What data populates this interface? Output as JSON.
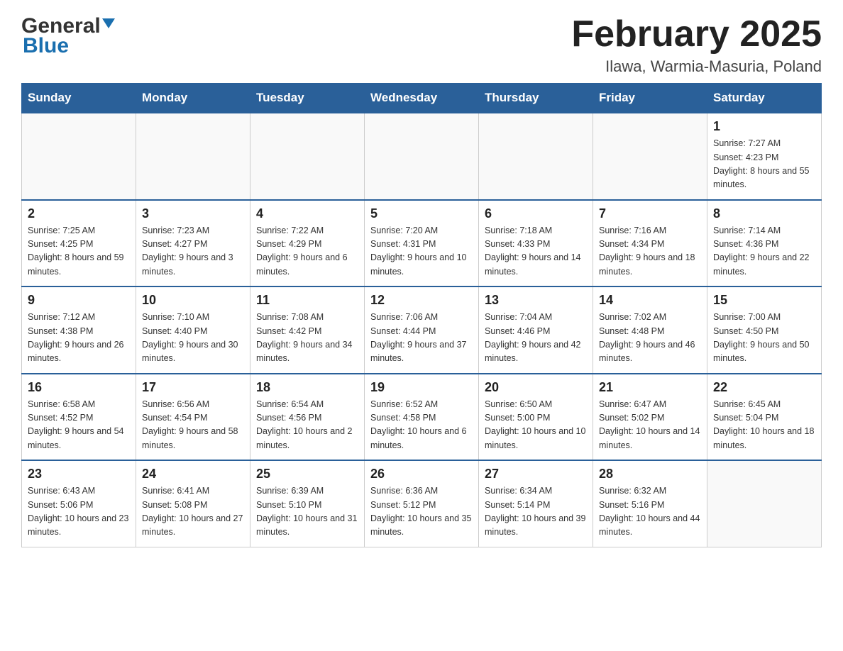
{
  "header": {
    "logo_main": "General",
    "logo_accent": "Blue",
    "month_title": "February 2025",
    "location": "Ilawa, Warmia-Masuria, Poland"
  },
  "weekdays": [
    "Sunday",
    "Monday",
    "Tuesday",
    "Wednesday",
    "Thursday",
    "Friday",
    "Saturday"
  ],
  "weeks": [
    [
      {
        "day": "",
        "info": ""
      },
      {
        "day": "",
        "info": ""
      },
      {
        "day": "",
        "info": ""
      },
      {
        "day": "",
        "info": ""
      },
      {
        "day": "",
        "info": ""
      },
      {
        "day": "",
        "info": ""
      },
      {
        "day": "1",
        "info": "Sunrise: 7:27 AM\nSunset: 4:23 PM\nDaylight: 8 hours and 55 minutes."
      }
    ],
    [
      {
        "day": "2",
        "info": "Sunrise: 7:25 AM\nSunset: 4:25 PM\nDaylight: 8 hours and 59 minutes."
      },
      {
        "day": "3",
        "info": "Sunrise: 7:23 AM\nSunset: 4:27 PM\nDaylight: 9 hours and 3 minutes."
      },
      {
        "day": "4",
        "info": "Sunrise: 7:22 AM\nSunset: 4:29 PM\nDaylight: 9 hours and 6 minutes."
      },
      {
        "day": "5",
        "info": "Sunrise: 7:20 AM\nSunset: 4:31 PM\nDaylight: 9 hours and 10 minutes."
      },
      {
        "day": "6",
        "info": "Sunrise: 7:18 AM\nSunset: 4:33 PM\nDaylight: 9 hours and 14 minutes."
      },
      {
        "day": "7",
        "info": "Sunrise: 7:16 AM\nSunset: 4:34 PM\nDaylight: 9 hours and 18 minutes."
      },
      {
        "day": "8",
        "info": "Sunrise: 7:14 AM\nSunset: 4:36 PM\nDaylight: 9 hours and 22 minutes."
      }
    ],
    [
      {
        "day": "9",
        "info": "Sunrise: 7:12 AM\nSunset: 4:38 PM\nDaylight: 9 hours and 26 minutes."
      },
      {
        "day": "10",
        "info": "Sunrise: 7:10 AM\nSunset: 4:40 PM\nDaylight: 9 hours and 30 minutes."
      },
      {
        "day": "11",
        "info": "Sunrise: 7:08 AM\nSunset: 4:42 PM\nDaylight: 9 hours and 34 minutes."
      },
      {
        "day": "12",
        "info": "Sunrise: 7:06 AM\nSunset: 4:44 PM\nDaylight: 9 hours and 37 minutes."
      },
      {
        "day": "13",
        "info": "Sunrise: 7:04 AM\nSunset: 4:46 PM\nDaylight: 9 hours and 42 minutes."
      },
      {
        "day": "14",
        "info": "Sunrise: 7:02 AM\nSunset: 4:48 PM\nDaylight: 9 hours and 46 minutes."
      },
      {
        "day": "15",
        "info": "Sunrise: 7:00 AM\nSunset: 4:50 PM\nDaylight: 9 hours and 50 minutes."
      }
    ],
    [
      {
        "day": "16",
        "info": "Sunrise: 6:58 AM\nSunset: 4:52 PM\nDaylight: 9 hours and 54 minutes."
      },
      {
        "day": "17",
        "info": "Sunrise: 6:56 AM\nSunset: 4:54 PM\nDaylight: 9 hours and 58 minutes."
      },
      {
        "day": "18",
        "info": "Sunrise: 6:54 AM\nSunset: 4:56 PM\nDaylight: 10 hours and 2 minutes."
      },
      {
        "day": "19",
        "info": "Sunrise: 6:52 AM\nSunset: 4:58 PM\nDaylight: 10 hours and 6 minutes."
      },
      {
        "day": "20",
        "info": "Sunrise: 6:50 AM\nSunset: 5:00 PM\nDaylight: 10 hours and 10 minutes."
      },
      {
        "day": "21",
        "info": "Sunrise: 6:47 AM\nSunset: 5:02 PM\nDaylight: 10 hours and 14 minutes."
      },
      {
        "day": "22",
        "info": "Sunrise: 6:45 AM\nSunset: 5:04 PM\nDaylight: 10 hours and 18 minutes."
      }
    ],
    [
      {
        "day": "23",
        "info": "Sunrise: 6:43 AM\nSunset: 5:06 PM\nDaylight: 10 hours and 23 minutes."
      },
      {
        "day": "24",
        "info": "Sunrise: 6:41 AM\nSunset: 5:08 PM\nDaylight: 10 hours and 27 minutes."
      },
      {
        "day": "25",
        "info": "Sunrise: 6:39 AM\nSunset: 5:10 PM\nDaylight: 10 hours and 31 minutes."
      },
      {
        "day": "26",
        "info": "Sunrise: 6:36 AM\nSunset: 5:12 PM\nDaylight: 10 hours and 35 minutes."
      },
      {
        "day": "27",
        "info": "Sunrise: 6:34 AM\nSunset: 5:14 PM\nDaylight: 10 hours and 39 minutes."
      },
      {
        "day": "28",
        "info": "Sunrise: 6:32 AM\nSunset: 5:16 PM\nDaylight: 10 hours and 44 minutes."
      },
      {
        "day": "",
        "info": ""
      }
    ]
  ]
}
